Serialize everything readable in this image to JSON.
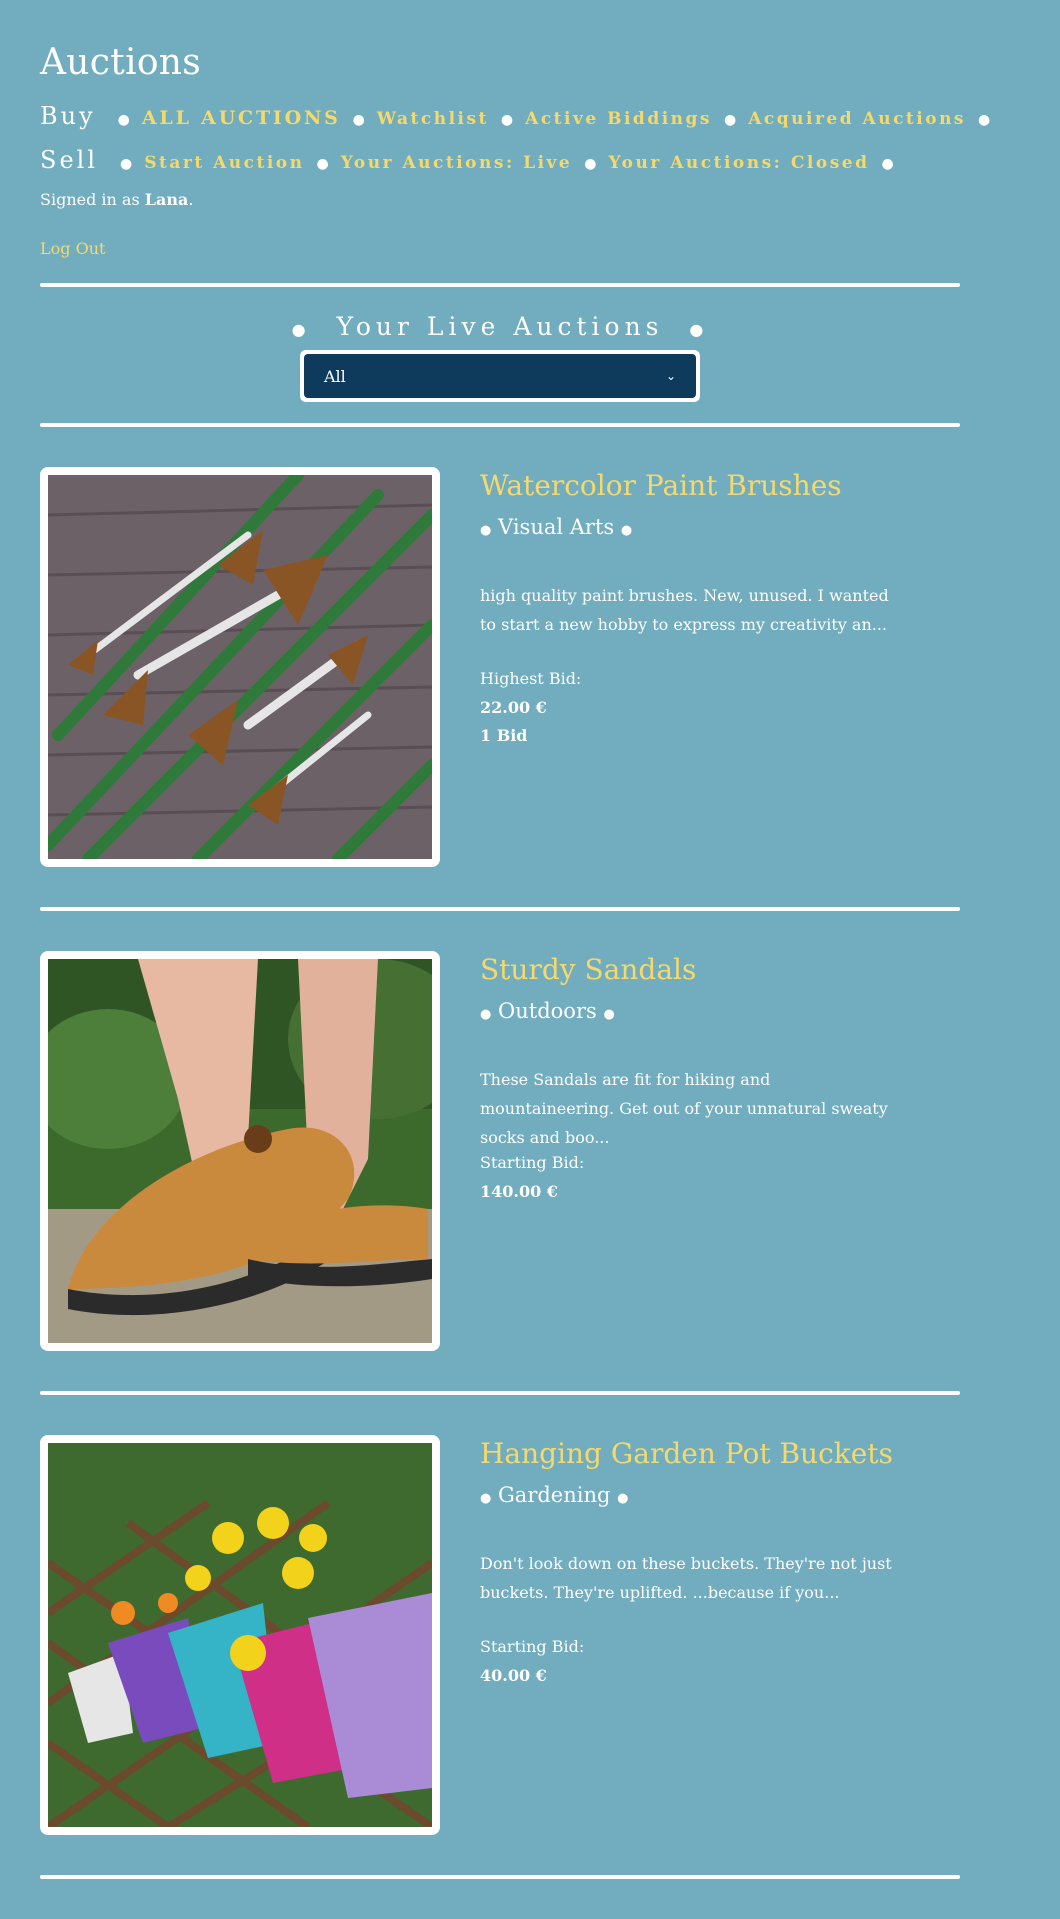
{
  "site": {
    "title": "Auctions"
  },
  "nav": {
    "buy_heading": "Buy",
    "buy_links": [
      "ALL AUCTIONS",
      "Watchlist",
      "Active Biddings",
      "Acquired Auctions"
    ],
    "sell_heading": "Sell",
    "sell_links": [
      "Start Auction",
      "Your Auctions: Live",
      "Your Auctions: Closed"
    ]
  },
  "user": {
    "prefix": "Signed in as ",
    "name": "Lana",
    "suffix": ".",
    "logout_label": "Log Out"
  },
  "section": {
    "title": "Your Live Auctions",
    "filter_value": "All"
  },
  "listings": [
    {
      "title": "Watercolor Paint Brushes",
      "category": "Visual Arts",
      "description": "high quality paint brushes. New, unused. I wanted to start a new hobby to express my creativity an...",
      "bid_label": "Highest Bid:",
      "bid_value": "22.00 €",
      "bid_count": "1 Bid"
    },
    {
      "title": "Sturdy Sandals",
      "category": "Outdoors",
      "description": "These Sandals are fit for hiking and mountaineering. Get out of your unnatural sweaty socks and boo...",
      "bid_label": "Starting Bid:",
      "bid_value": "140.00 €"
    },
    {
      "title": "Hanging Garden Pot Buckets",
      "category": "Gardening",
      "description": "Don't look down on these buckets. They're not just buckets. They're uplifted. ...because if you...",
      "bid_label": "Starting Bid:",
      "bid_value": "40.00 €"
    }
  ],
  "colors": {
    "background": "#72adbf",
    "accent": "#f6d96b",
    "select_bg": "#0e3a5c",
    "rule": "#ffffff"
  }
}
